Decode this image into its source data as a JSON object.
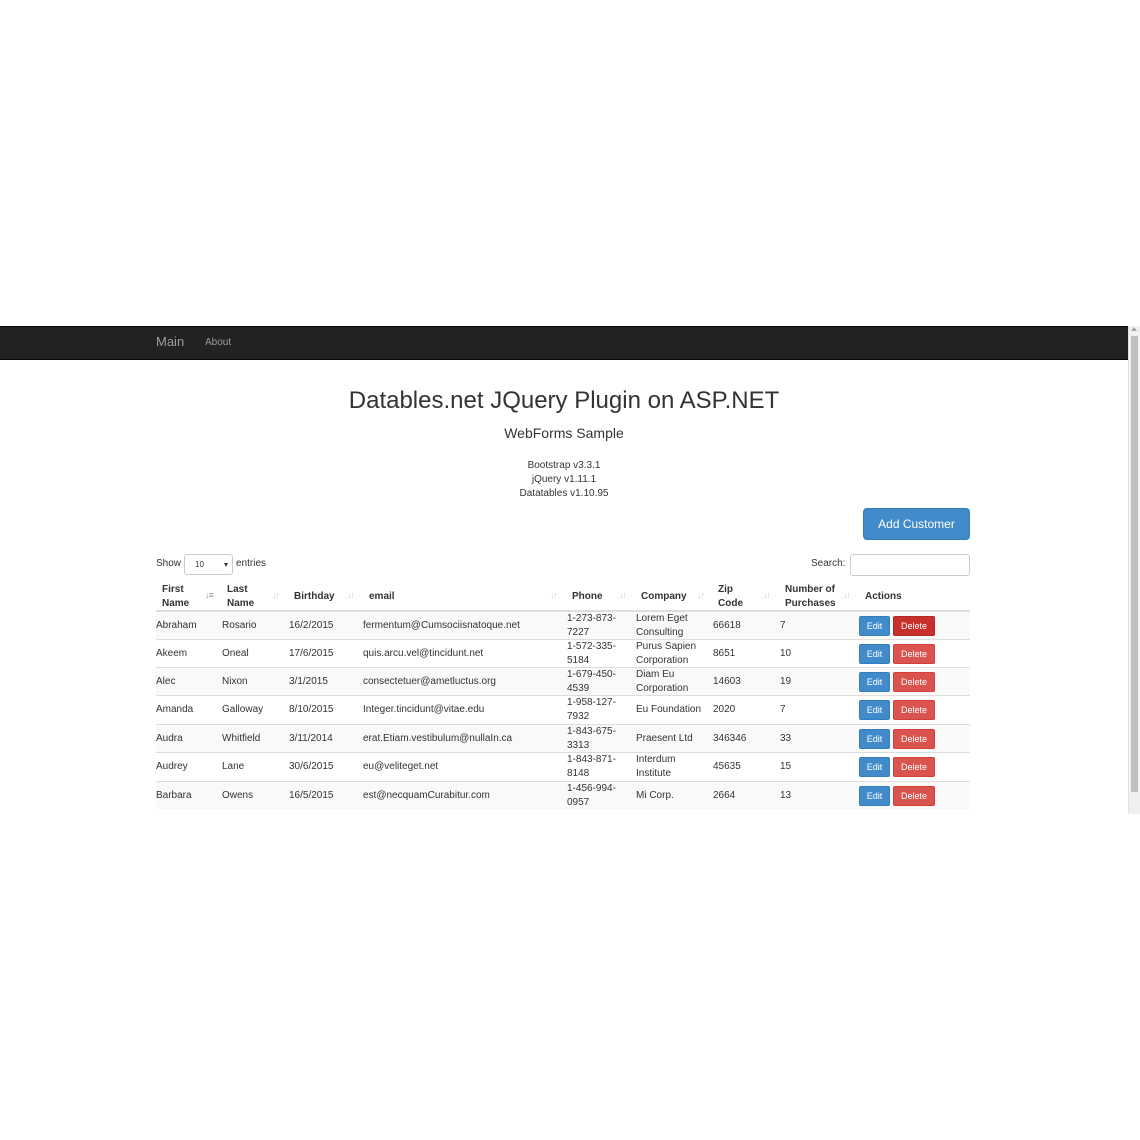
{
  "nav": {
    "brand": "Main",
    "links": [
      "About"
    ]
  },
  "header": {
    "title": "Datables.net JQuery Plugin on ASP.NET",
    "subtitle": "WebForms Sample",
    "versions": [
      "Bootstrap v3.3.1",
      "jQuery v1.11.1",
      "Datatables v1.10.95"
    ]
  },
  "toolbar": {
    "add_label": "Add Customer"
  },
  "length": {
    "show": "Show",
    "value": "10",
    "entries": "entries"
  },
  "search": {
    "label": "Search:",
    "value": ""
  },
  "table": {
    "columns": [
      "First Name",
      "Last Name",
      "Birthday",
      "email",
      "Phone",
      "Company",
      "Zip Code",
      "Number of Purchases",
      "Actions"
    ],
    "rows": [
      {
        "first": "Abraham",
        "last": "Rosario",
        "birthday": "16/2/2015",
        "email": "fermentum@Cumsociisnatoque.net",
        "phone": "1-273-873-7227",
        "company": "Lorem Eget Consulting",
        "zip": "66618",
        "purchases": "7"
      },
      {
        "first": "Akeem",
        "last": "Oneal",
        "birthday": "17/6/2015",
        "email": "quis.arcu.vel@tincidunt.net",
        "phone": "1-572-335-5184",
        "company": "Purus Sapien Corporation",
        "zip": "8651",
        "purchases": "10"
      },
      {
        "first": "Alec",
        "last": "Nixon",
        "birthday": "3/1/2015",
        "email": "consectetuer@ametluctus.org",
        "phone": "1-679-450-4539",
        "company": "Diam Eu Corporation",
        "zip": "14603",
        "purchases": "19"
      },
      {
        "first": "Amanda",
        "last": "Galloway",
        "birthday": "8/10/2015",
        "email": "Integer.tincidunt@vitae.edu",
        "phone": "1-958-127-7932",
        "company": "Eu Foundation",
        "zip": "2020",
        "purchases": "7"
      },
      {
        "first": "Audra",
        "last": "Whitfield",
        "birthday": "3/11/2014",
        "email": "erat.Etiam.vestibulum@nullaIn.ca",
        "phone": "1-843-675-3313",
        "company": "Praesent Ltd",
        "zip": "346346",
        "purchases": "33"
      },
      {
        "first": "Audrey",
        "last": "Lane",
        "birthday": "30/6/2015",
        "email": "eu@veliteget.net",
        "phone": "1-843-871-8148",
        "company": "Interdum Institute",
        "zip": "45635",
        "purchases": "15"
      },
      {
        "first": "Barbara",
        "last": "Owens",
        "birthday": "16/5/2015",
        "email": "est@necquamCurabitur.com",
        "phone": "1-456-994-0957",
        "company": "Mi Corp.",
        "zip": "2664",
        "purchases": "13"
      }
    ],
    "edit_label": "Edit",
    "delete_label": "Delete"
  },
  "colors": {
    "navbar": "#222222",
    "primary": "#428bca",
    "danger": "#d9534f",
    "danger_active": "#c9302c",
    "stripe": "#f9f9f9"
  },
  "icons": {
    "sort": "sort-both-icon",
    "sort_active": "sort-ascending-icon"
  }
}
